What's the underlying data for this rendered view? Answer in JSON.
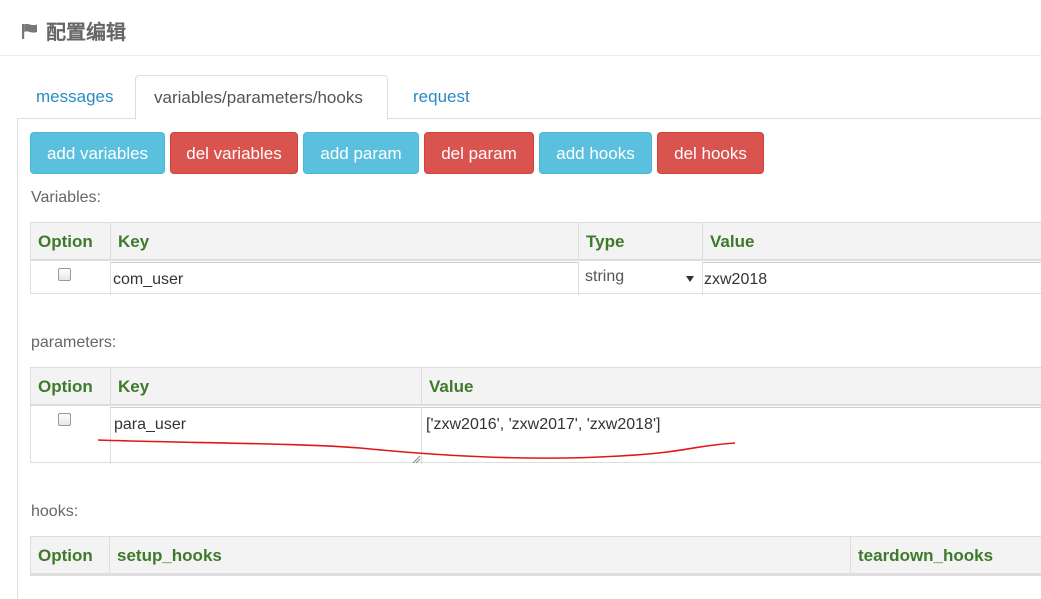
{
  "header": {
    "title": "配置编辑",
    "icon": "flag-icon"
  },
  "tabs": [
    {
      "label": "messages",
      "active": false
    },
    {
      "label": "variables/parameters/hooks",
      "active": true
    },
    {
      "label": "request",
      "active": false
    }
  ],
  "toolbar": {
    "add_variables": "add variables",
    "del_variables": "del variables",
    "add_param": "add param",
    "del_param": "del param",
    "add_hooks": "add hooks",
    "del_hooks": "del hooks"
  },
  "colors": {
    "info": "#5bc0de",
    "danger": "#d9534f",
    "header_text": "#3d7a2c",
    "link": "#2a8bc4",
    "annotation": "#e0161a"
  },
  "variables": {
    "label": "Variables:",
    "columns": [
      "Option",
      "Key",
      "Type",
      "Value"
    ],
    "rows": [
      {
        "key": "com_user",
        "type": "string",
        "value": "zxw2018",
        "checked": false
      }
    ]
  },
  "parameters": {
    "label": "parameters:",
    "columns": [
      "Option",
      "Key",
      "Value"
    ],
    "rows": [
      {
        "key": "para_user",
        "value": "['zxw2016', 'zxw2017', 'zxw2018']",
        "checked": false
      }
    ]
  },
  "hooks": {
    "label": "hooks:",
    "columns": [
      "Option",
      "setup_hooks",
      "teardown_hooks"
    ]
  }
}
